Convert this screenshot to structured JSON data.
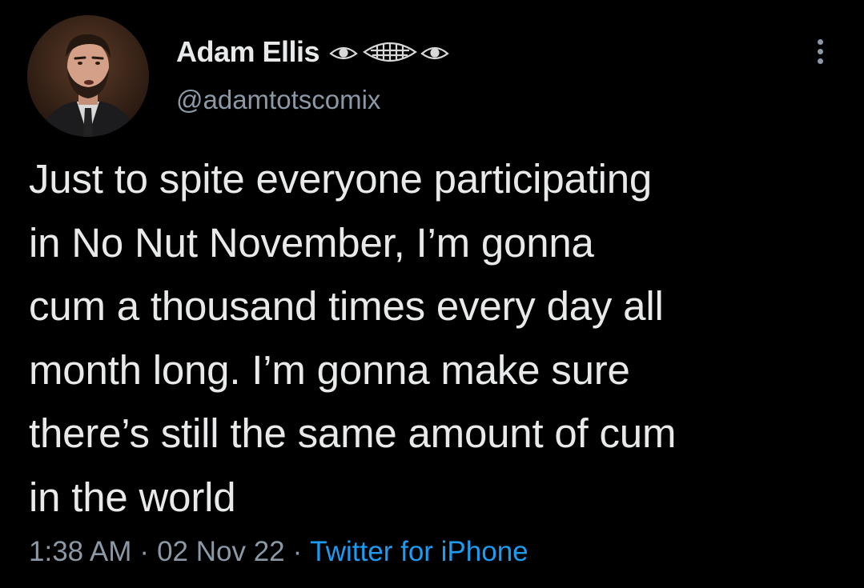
{
  "author": {
    "display_name": "Adam Ellis",
    "handle": "@adamtotscomix",
    "name_decoration_icon": "eye-emoji-icons"
  },
  "tweet": {
    "lines": [
      "Just to spite everyone participating",
      "in No Nut November, I’m gonna",
      "cum a thousand times every day all",
      "month long. I’m gonna make sure",
      "there’s still the same amount of cum",
      "in the world"
    ]
  },
  "meta": {
    "time": "1:38 AM",
    "separator": "·",
    "date": "02 Nov 22",
    "source": "Twitter for iPhone"
  },
  "icons": {
    "more": "more-vertical-icon"
  },
  "colors": {
    "background": "#000000",
    "text_primary": "#e7e9ea",
    "text_secondary": "#8b98a5",
    "link": "#1d9bf0"
  }
}
